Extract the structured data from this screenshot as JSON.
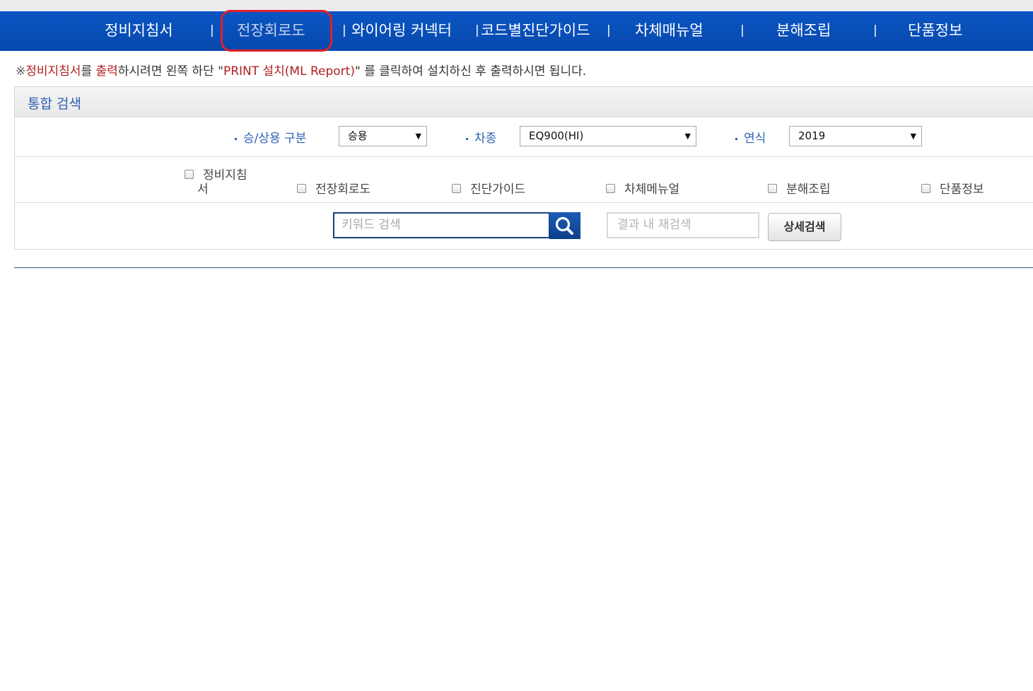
{
  "nav": {
    "items": [
      {
        "label": "정비지침서"
      },
      {
        "label": "전장회로도"
      },
      {
        "label": "와이어링 커넥터"
      },
      {
        "label": "코드별진단가이드"
      },
      {
        "label": "차체매뉴얼"
      },
      {
        "label": "분해조립"
      },
      {
        "label": "단품정보"
      }
    ],
    "separator": "|"
  },
  "notice": {
    "mark": "※",
    "part1": "정비지침서",
    "part2": "를 ",
    "part3": "출력",
    "part4": "하시려면 왼쪽 하단 \"",
    "part5": "PRINT 설치(ML Report)",
    "part6": "\" 를 클릭하여 설치하신 후 출력하시면 됩니다."
  },
  "search": {
    "title": "통합 검색",
    "vehicle_type": {
      "label": "승/상용 구분",
      "value": "승용"
    },
    "model": {
      "label": "차종",
      "value": "EQ900(HI)"
    },
    "year": {
      "label": "연식",
      "value": "2019"
    },
    "checkboxes": [
      {
        "label_line1": "정비지침",
        "label_line2": "서"
      },
      {
        "label": "전장회로도"
      },
      {
        "label": "진단가이드"
      },
      {
        "label": "차체메뉴얼"
      },
      {
        "label": "분해조립"
      },
      {
        "label": "단품정보"
      }
    ],
    "keyword_placeholder": "키워드 검색",
    "refine_placeholder": "결과 내 재검색",
    "detail_button": "상세검색"
  },
  "colors": {
    "nav_bg": "#0a55c3",
    "highlight": "#e0202a",
    "label_blue": "#2f63b4",
    "notice_red": "#b02020"
  },
  "icons": {
    "search": "magnifier-icon",
    "dropdown": "caret-down-icon"
  }
}
